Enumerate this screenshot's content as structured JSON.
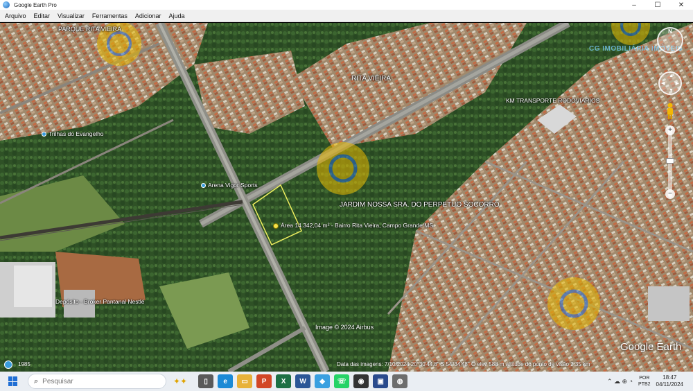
{
  "window": {
    "title": "Google Earth Pro",
    "controls": [
      "–",
      "☐",
      "✕"
    ]
  },
  "menu": [
    "Arquivo",
    "Editar",
    "Visualizar",
    "Ferramentas",
    "Adicionar",
    "Ajuda"
  ],
  "map": {
    "places": {
      "parque_rita_vieira": "PARQUE RITA VIEIRA",
      "rita_vieira": "RITA VIEIRA",
      "km_transporte": "KM TRANSPORTE RODOVIARIOS",
      "eclipse_trilhas": "Trilhas do Evangelho",
      "arena": "Arena Vigor Sports",
      "jardim": "JARDIM NOSSA SRA. DO PERPETUO SOCORRO",
      "area_label": "Área 14.342,04 m² - Bairro Rita Vieira, Campo Grande MS",
      "nestle": "Depósito - Broker Pantanal Nestlé"
    },
    "watermark_text": "CG IMOBILIÁRIA IMÓVEIS",
    "attribution": "Image © 2024 Airbus",
    "logo": "Google Earth",
    "year": "1985",
    "status": "Data das imagens: 7/10/2024    20°30'44.8\" S    54°34'48\" O    elev 588 m    altitude do ponto de visão 2.35 km"
  },
  "taskbar": {
    "search_placeholder": "Pesquisar",
    "lang_top": "POR",
    "lang_bottom": "PTB2",
    "time": "18:47",
    "date": "04/11/2024"
  }
}
